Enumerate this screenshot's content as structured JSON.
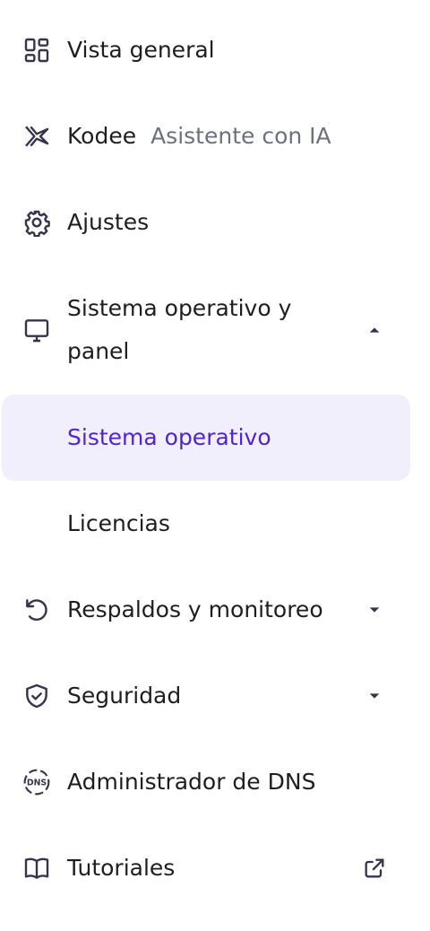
{
  "menu": {
    "overview": {
      "label": "Vista general",
      "icon": "grid-icon"
    },
    "kodee": {
      "label": "Kodee",
      "sublabel": "Asistente con IA",
      "icon": "kodee-icon"
    },
    "settings": {
      "label": "Ajustes",
      "icon": "gear-icon"
    },
    "os_panel": {
      "label": "Sistema operativo y panel",
      "icon": "monitor-icon",
      "expanded": true,
      "children": [
        {
          "label": "Sistema operativo",
          "active": true
        },
        {
          "label": "Licencias",
          "active": false
        }
      ]
    },
    "backups": {
      "label": "Respaldos y monitoreo",
      "icon": "restore-icon",
      "expanded": false
    },
    "security": {
      "label": "Seguridad",
      "icon": "shield-check-icon",
      "expanded": false
    },
    "dns": {
      "label": "Administrador de DNS",
      "icon": "dns-icon"
    },
    "tutorials": {
      "label": "Tutoriales",
      "icon": "book-icon",
      "external_icon": "external-link-icon"
    }
  },
  "colors": {
    "active_text": "#5025d1",
    "active_bg": "#f1effc",
    "text": "#1d1e20",
    "muted": "#6d7081",
    "icon": "#36344d"
  }
}
